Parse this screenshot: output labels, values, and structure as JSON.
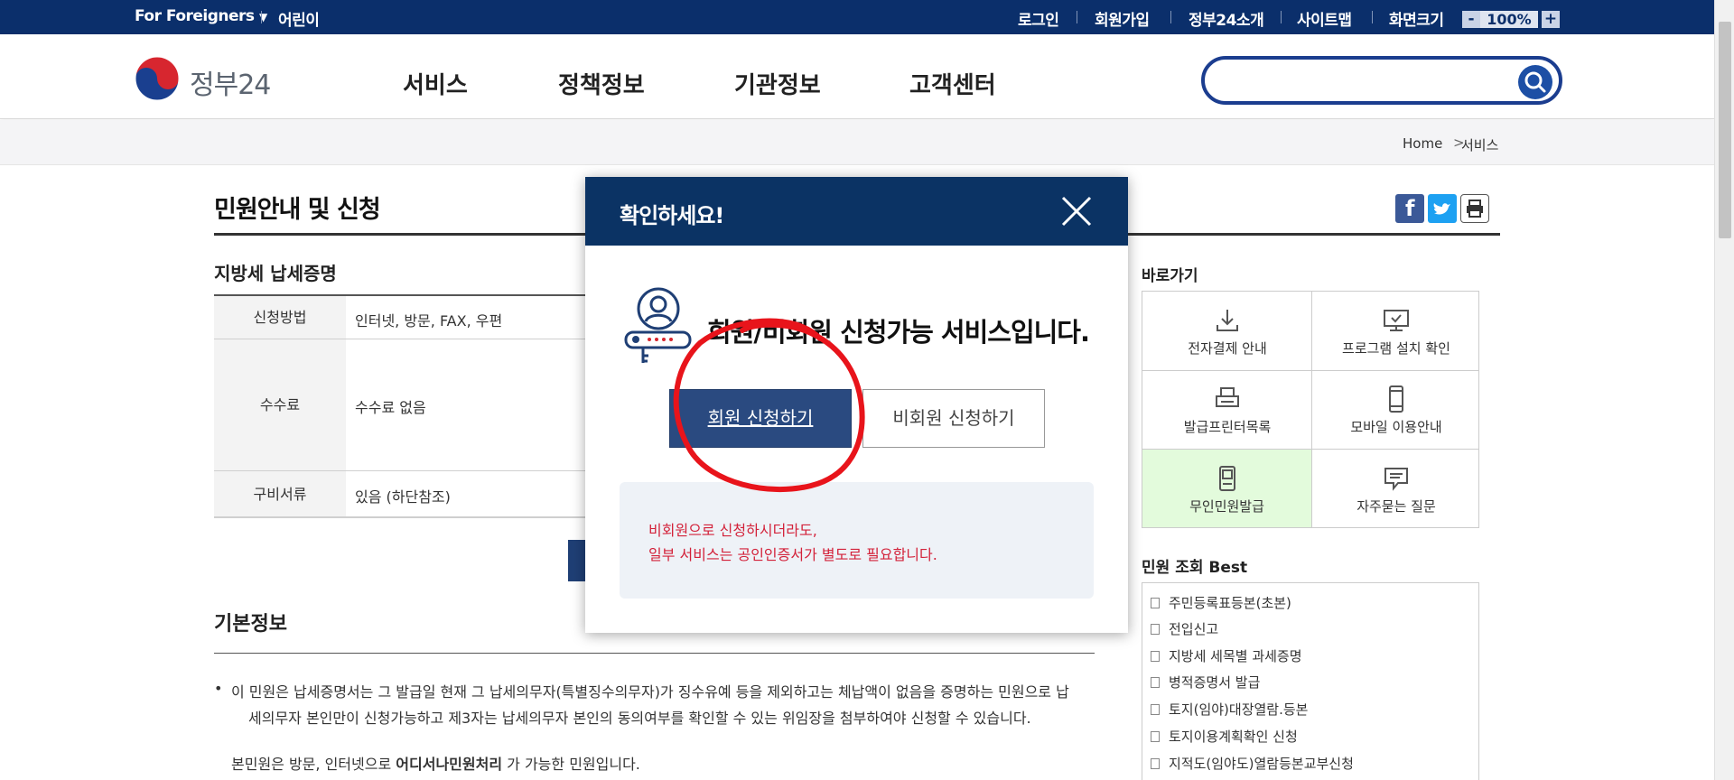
{
  "topbar": {
    "foreigners": "For Foreigners",
    "kids": "어린이",
    "links": [
      "로그인",
      "회원가입",
      "정부24소개",
      "사이트맵"
    ],
    "zoom_label": "화면크기",
    "zoom_minus": "-",
    "zoom_value": "100%",
    "zoom_plus": "+"
  },
  "header": {
    "logo_text": "정부24",
    "nav": [
      "서비스",
      "정책정보",
      "기관정보",
      "고객센터"
    ],
    "search_value": ""
  },
  "breadcrumb": {
    "home": "Home",
    "separator": ">",
    "current": "서비스"
  },
  "page": {
    "title": "민원안내 및 신청",
    "subtitle": "지방세 납세증명",
    "table": [
      {
        "label": "신청방법",
        "value": "인터넷, 방문, FAX, 우편"
      },
      {
        "label": "수수료",
        "value": "수수료 없음"
      },
      {
        "label": "구비서류",
        "value": "있음 (하단참조)"
      }
    ],
    "basic_info_title": "기본정보",
    "bullet": "•",
    "basic_info_line1": "이 민원은 납세증명서는 그 발급일 현재 그 납세의무자(특별징수의무자)가 징수유예 등을 제외하고는 체납액이 없음을 증명하는 민원으로 납",
    "basic_info_line2": "세의무자 본인만이 신청가능하고 제3자는 납세의무자 본인의 동의여부를 확인할 수 있는 위임장을 첨부하여야 신청할 수 있습니다.",
    "basic_info_line3_pre": "본민원은 방문, 인터넷으로",
    "basic_info_line3_bold": "어디서나민원처리",
    "basic_info_line3_post": "가 가능한 민원입니다."
  },
  "sidebar": {
    "quick_title": "바로가기",
    "quick_links": [
      {
        "label": "전자결제 안내",
        "icon": "download-icon"
      },
      {
        "label": "프로그램 설치 확인",
        "icon": "monitor-check-icon"
      },
      {
        "label": "발급프린터목록",
        "icon": "printer-icon"
      },
      {
        "label": "모바일 이용안내",
        "icon": "mobile-icon"
      },
      {
        "label": "무인민원발급",
        "icon": "kiosk-icon"
      },
      {
        "label": "자주묻는 질문",
        "icon": "chat-bubble-icon"
      }
    ],
    "best_title": "민원 조회 Best",
    "best_items": [
      "주민등록표등본(초본)",
      "전입신고",
      "지방세 세목별 과세증명",
      "병적증명서 발급",
      "토지(임야)대장열람.등본",
      "토지이용계획확인 신청",
      "지적도(임야도)열람등본교부신청"
    ]
  },
  "modal": {
    "title": "확인하세요!",
    "message": "회원/비회원 신청가능 서비스입니다.",
    "member_button": "회원 신청하기",
    "guest_button": "비회원 신청하기",
    "note_line1": "비회원으로 신청하시더라도,",
    "note_line2": "일부 서비스는 공인인증서가 별도로 필요합니다."
  },
  "colors": {
    "topbar": "#0b2f6b",
    "modal_header": "#0b3364",
    "member_button": "#2a4a80",
    "note_text": "#d3223a",
    "annotation": "#e8141b",
    "kiosk_highlight": "#e3fbdc"
  }
}
